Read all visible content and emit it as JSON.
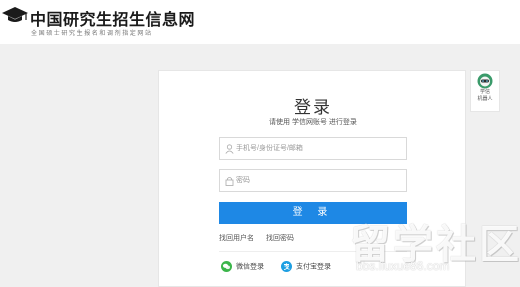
{
  "header": {
    "title": "中国研究生招生信息网",
    "subtitle": "全国硕士研究生报名和调剂指定网站"
  },
  "login": {
    "title": "登录",
    "subtitle": "请使用 学信网账号 进行登录",
    "username_placeholder": "手机号/身份证号/邮箱",
    "password_placeholder": "密码",
    "submit_label": "登 录",
    "find_account": "找回用户名",
    "find_password": "找回密码",
    "wechat_login": "微信登录",
    "alipay_login": "支付宝登录"
  },
  "side_widget": {
    "line1": "学信",
    "line2": "机器人"
  },
  "watermark": {
    "text": "留学社区",
    "url": "bbs.liuxue86.com"
  },
  "colors": {
    "primary": "#1e88e5",
    "wechat": "#3bb54a",
    "alipay": "#1e9fe2"
  },
  "icons": [
    "graduation-cap-icon",
    "user-icon",
    "lock-icon",
    "wechat-icon",
    "alipay-icon",
    "robot-icon"
  ]
}
